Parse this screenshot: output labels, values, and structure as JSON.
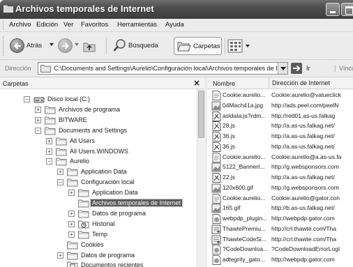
{
  "window": {
    "title": "Archivos temporales de Internet",
    "icon": "folder-icon"
  },
  "menu": [
    "Archivo",
    "Edición",
    "Ver",
    "Favoritos",
    "Herramientas",
    "Ayuda"
  ],
  "toolbar": {
    "back_label": "Atrás",
    "search_label": "Búsqueda",
    "folders_label": "Carpetas"
  },
  "address": {
    "label": "Dirección",
    "value": "C:\\Documents and Settings\\Aurelio\\Configuración local\\Archivos temporales de Internet",
    "go_label": "Ir",
    "links_label": "Vínculos"
  },
  "folders_pane": {
    "title": "Carpetas",
    "close": "×",
    "tree": [
      {
        "label": "Disco local (C:)",
        "expander": "−",
        "icon": "drive-icon"
      },
      {
        "label": "Archivos de programa",
        "expander": "+",
        "icon": "folder-icon"
      },
      {
        "label": "BITWARE",
        "expander": "+",
        "icon": "folder-icon"
      },
      {
        "label": "Documents and Settings",
        "expander": "−",
        "icon": "folder-icon"
      },
      {
        "label": "All Users",
        "expander": "+",
        "icon": "folder-icon"
      },
      {
        "label": "All Users.WINDOWS",
        "expander": "+",
        "icon": "folder-icon"
      },
      {
        "label": "Aurelio",
        "expander": "−",
        "icon": "folder-icon"
      },
      {
        "label": "Application Data",
        "expander": "+",
        "icon": "folder-icon"
      },
      {
        "label": "Configuración local",
        "expander": "−",
        "icon": "folder-icon"
      },
      {
        "label": "Application Data",
        "expander": "+",
        "icon": "folder-icon"
      },
      {
        "label": "Archivos temporales de Internet",
        "expander": "",
        "icon": "folder-icon",
        "selected": true
      },
      {
        "label": "Datos de programa",
        "expander": "+",
        "icon": "folder-icon"
      },
      {
        "label": "Historial",
        "expander": "+",
        "icon": "history-folder-icon"
      },
      {
        "label": "Temp",
        "expander": "+",
        "icon": "folder-icon"
      },
      {
        "label": "Cookies",
        "expander": "",
        "icon": "folder-icon"
      },
      {
        "label": "Datos de programa",
        "expander": "+",
        "icon": "folder-icon"
      },
      {
        "label": "Documentos recientes",
        "expander": "",
        "icon": "recent-docs-icon"
      }
    ]
  },
  "file_list": {
    "columns": [
      "Nombre",
      "Dirección de Internet"
    ],
    "rows": [
      {
        "name": "Cookie:aurelio...",
        "address": "Cookie:aurelio@valueclick",
        "icon": "text-file-icon"
      },
      {
        "name": "04Mach41a.jpg",
        "address": "http://ads.peel.com/peelN",
        "icon": "image-file-icon"
      },
      {
        "name": "asldata.js?rdm...",
        "address": "http://red01.as-us.falkag",
        "icon": "script-file-icon"
      },
      {
        "name": "28.js",
        "address": "http://a.as-us.falkag.net/",
        "icon": "script-file-icon"
      },
      {
        "name": "36.js",
        "address": "http://a.as-us.falkag.net/",
        "icon": "script-file-icon"
      },
      {
        "name": "36.js",
        "address": "http://a.as-us.falkag.net/",
        "icon": "script-file-icon"
      },
      {
        "name": "Cookie:aurelio...",
        "address": "Cookie:aurelio@a.as-us.fa",
        "icon": "text-file-icon"
      },
      {
        "name": "5122_BannerI...",
        "address": "http://g.websponsors.com",
        "icon": "image-file-icon"
      },
      {
        "name": "22.js",
        "address": "http://a.as-us.falkag.net/",
        "icon": "script-file-icon"
      },
      {
        "name": "120x600.gif",
        "address": "http://g.websponsors.com",
        "icon": "image-file-icon"
      },
      {
        "name": "Cookie:aurelio...",
        "address": "Cookie:aurelio@gator.con",
        "icon": "text-file-icon"
      },
      {
        "name": "165.gif",
        "address": "http://b.as-us.falkag.net/",
        "icon": "image-file-icon"
      },
      {
        "name": "webpdp_plugin...",
        "address": "http://webpdp.gator.com",
        "icon": "web-file-icon"
      },
      {
        "name": "ThawtePremiu...",
        "address": "http://crl.thawte.com/Tha",
        "icon": "cert-file-icon"
      },
      {
        "name": "ThawteCodeSi...",
        "address": "http://crl.thawte.com/Tha",
        "icon": "cert-file-icon"
      },
      {
        "name": "?CodeDownloa...",
        "address": "?CodeDownloadErrorLogI",
        "icon": "web-file-icon"
      },
      {
        "name": "adtegrity_gato...",
        "address": "http://webpdp.gator.com",
        "icon": "web-file-icon"
      }
    ]
  }
}
